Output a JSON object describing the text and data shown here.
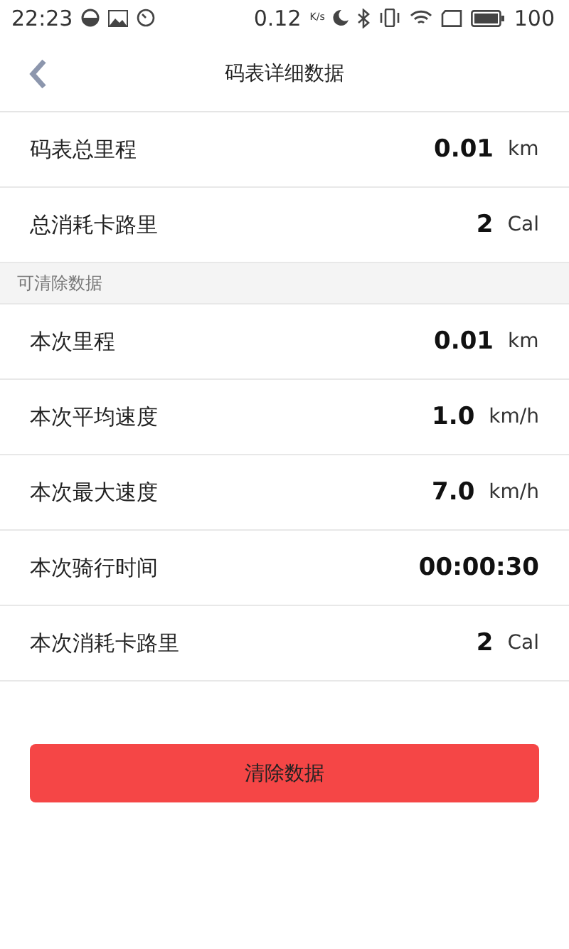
{
  "status_bar": {
    "time": "22:23",
    "speed": "0.12",
    "speed_unit": "K/s",
    "battery": "100"
  },
  "header": {
    "title": "码表详细数据"
  },
  "totals": [
    {
      "label": "码表总里程",
      "value": "0.01",
      "unit": "km"
    },
    {
      "label": "总消耗卡路里",
      "value": "2",
      "unit": "Cal"
    }
  ],
  "section_label": "可清除数据",
  "current": [
    {
      "label": "本次里程",
      "value": "0.01",
      "unit": "km"
    },
    {
      "label": "本次平均速度",
      "value": "1.0",
      "unit": "km/h"
    },
    {
      "label": "本次最大速度",
      "value": "7.0",
      "unit": "km/h"
    },
    {
      "label": "本次骑行时间",
      "value": "00:00:30"
    },
    {
      "label": "本次消耗卡路里",
      "value": "2",
      "unit": "Cal"
    }
  ],
  "clear_button": "清除数据"
}
